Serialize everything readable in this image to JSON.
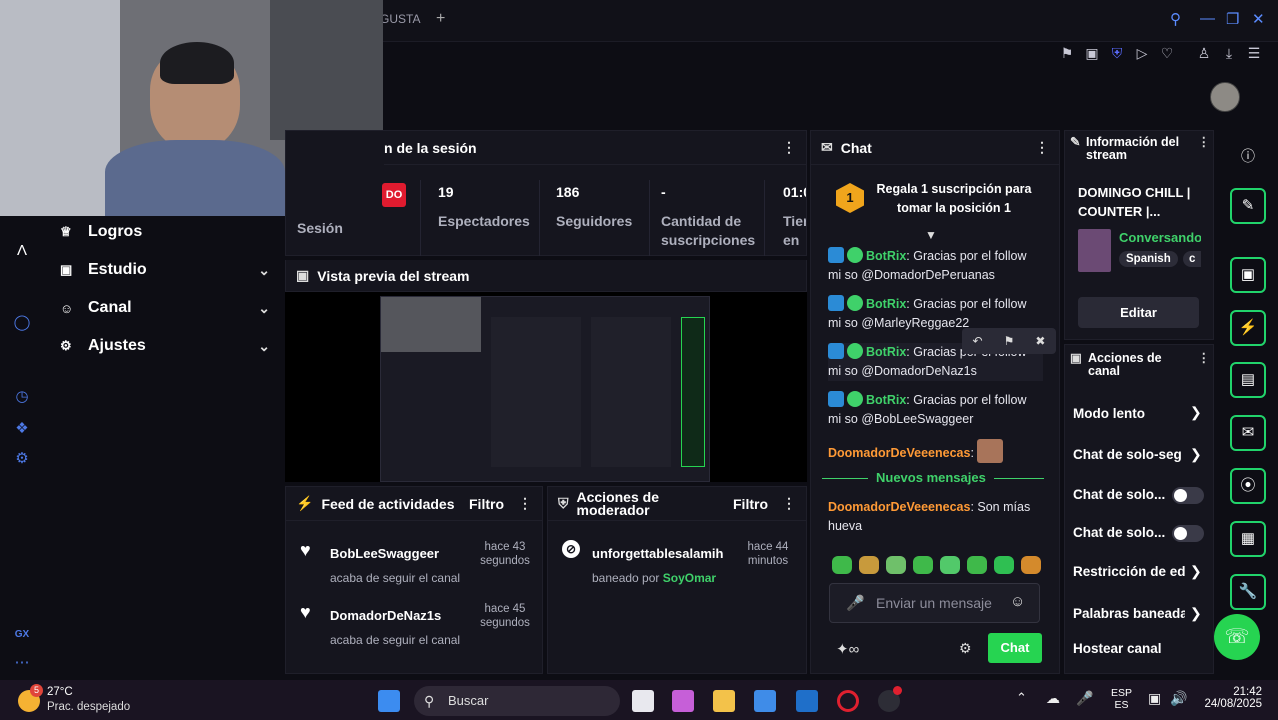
{
  "browser": {
    "tab_label": "GUSTA",
    "new_tab": "+"
  },
  "webcam": {
    "alt": "streamer webcam"
  },
  "nav": {
    "items": [
      {
        "label": "Logros",
        "icon": "trophy-icon",
        "chevron": false
      },
      {
        "label": "Estudio",
        "icon": "studio-icon",
        "chevron": true
      },
      {
        "label": "Canal",
        "icon": "channel-icon",
        "chevron": true
      },
      {
        "label": "Ajustes",
        "icon": "gear-icon",
        "chevron": true
      }
    ],
    "footer": "GX"
  },
  "session": {
    "title": "n de la sesión",
    "live_badge": "DO",
    "session_label": "Sesión",
    "stats": [
      {
        "value": "19",
        "label": "Espectadores"
      },
      {
        "value": "186",
        "label": "Seguidores"
      },
      {
        "value": "-",
        "label": "Cantidad de suscripciones"
      },
      {
        "value": "01:0",
        "label": "Tier en v"
      }
    ]
  },
  "preview": {
    "title": "Vista previa del stream"
  },
  "activity": {
    "title": "Feed de actividades",
    "filter": "Filtro",
    "items": [
      {
        "user": "BobLeeSwaggeer",
        "action": "acaba de seguir el canal",
        "time": "hace 43 segundos"
      },
      {
        "user": "DomadorDeNaz1s",
        "action": "acaba de seguir el canal",
        "time": "hace 45 segundos"
      }
    ]
  },
  "mod": {
    "title": "Acciones de moderador",
    "filter": "Filtro",
    "items": [
      {
        "user": "unforgettablesalamih",
        "action": "baneado por",
        "by": "SoyOmar",
        "time": "hace 44 minutos"
      }
    ]
  },
  "chat": {
    "title": "Chat",
    "gift_rank": "1",
    "gift_text": "Regala 1 suscripción para tomar la posición 1",
    "messages": [
      {
        "user": "BotRix",
        "text": "Gracias por el follow mi so @DomadorDePeruanas"
      },
      {
        "user": "BotRix",
        "text": "Gracias por el follow mi so @MarleyReggae22"
      },
      {
        "user": "BotRix",
        "text": "Gracias por el follow mi so @DomadorDeNaz1s"
      },
      {
        "user": "BotRix",
        "text": "Gracias por el follow mi so @BobLeeSwaggeer"
      }
    ],
    "emote_msg_user": "DoomadorDeVeeenecas",
    "new_messages": "Nuevos mensajes",
    "last_msg_user": "DoomadorDeVeeenecas",
    "last_msg_text": "Son mías hueva",
    "input_placeholder": "Enviar un mensaje",
    "send_label": "Chat"
  },
  "stream_info": {
    "title": "Información del stream",
    "stream_title": "DOMINGO CHILL | COUNTER |...",
    "category": "Conversando",
    "tags": [
      "Spanish",
      "c"
    ],
    "edit_label": "Editar"
  },
  "channel_actions": {
    "title": "Acciones de canal",
    "rows": [
      {
        "label": "Modo lento",
        "kind": "arrow"
      },
      {
        "label": "Chat de solo-seg",
        "kind": "arrow"
      },
      {
        "label": "Chat de solo...",
        "kind": "toggle"
      },
      {
        "label": "Chat de solo...",
        "kind": "toggle"
      },
      {
        "label": "Restricción de ed",
        "kind": "arrow"
      },
      {
        "label": "Palabras baneada",
        "kind": "arrow"
      },
      {
        "label": "Hostear canal",
        "kind": "none"
      }
    ]
  },
  "taskbar": {
    "weather_temp": "27°C",
    "weather_desc": "Prac. despejado",
    "weather_badge": "5",
    "search_label": "Buscar",
    "lang1": "ESP",
    "lang2": "ES",
    "time": "21:42",
    "date": "24/08/2025"
  },
  "colors": {
    "accent_green": "#26d451",
    "bot_green": "#3fd16a",
    "user_orange": "#ff9a36",
    "live_red": "#e01b2f"
  }
}
